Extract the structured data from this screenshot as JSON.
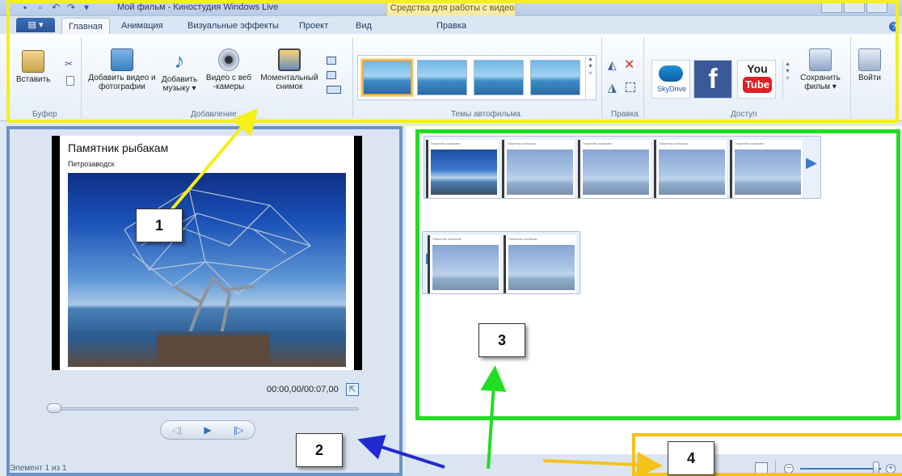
{
  "window": {
    "title": "Мой фильм - Киностудия Windows Live",
    "context_group": "Средства для работы с видео"
  },
  "tabs": {
    "file_label": "▤ ▾",
    "items": [
      "Главная",
      "Анимация",
      "Визуальные эффекты",
      "Проект",
      "Вид",
      "Правка"
    ]
  },
  "ribbon": {
    "clipboard": {
      "paste": "Вставить",
      "group": "Буфер"
    },
    "add": {
      "add_video": "Добавить видео и фотографии",
      "add_music": "Добавить музыку ▾",
      "webcam": "Видео с веб -камеры",
      "snapshot": "Моментальный снимок",
      "group": "Добавление"
    },
    "themes": {
      "group": "Темы автофильма"
    },
    "edit": {
      "group": "Правка"
    },
    "share": {
      "skydrive": "SkyDrive",
      "facebook": "f",
      "youtube_top": "You",
      "youtube_bottom": "Tube",
      "save_movie": "Сохранить фильм ▾",
      "group": "Доступ"
    },
    "signin": "Войти"
  },
  "preview": {
    "slide_title": "Памятник рыбакам",
    "slide_subtitle": "Петрозаводск",
    "timecode": "00:00,00/00:07,00",
    "status": "Элемент 1 из 1"
  },
  "storyboard": {
    "thumb_caption": "Памятник рыбакам"
  },
  "callouts": {
    "c1": "1",
    "c2": "2",
    "c3": "3",
    "c4": "4"
  },
  "colors": {
    "callout_1_border": "#f5ef1a",
    "callout_2_border": "#6a94c8",
    "callout_3_border": "#22dd22",
    "callout_4_border": "#f5c21a"
  }
}
